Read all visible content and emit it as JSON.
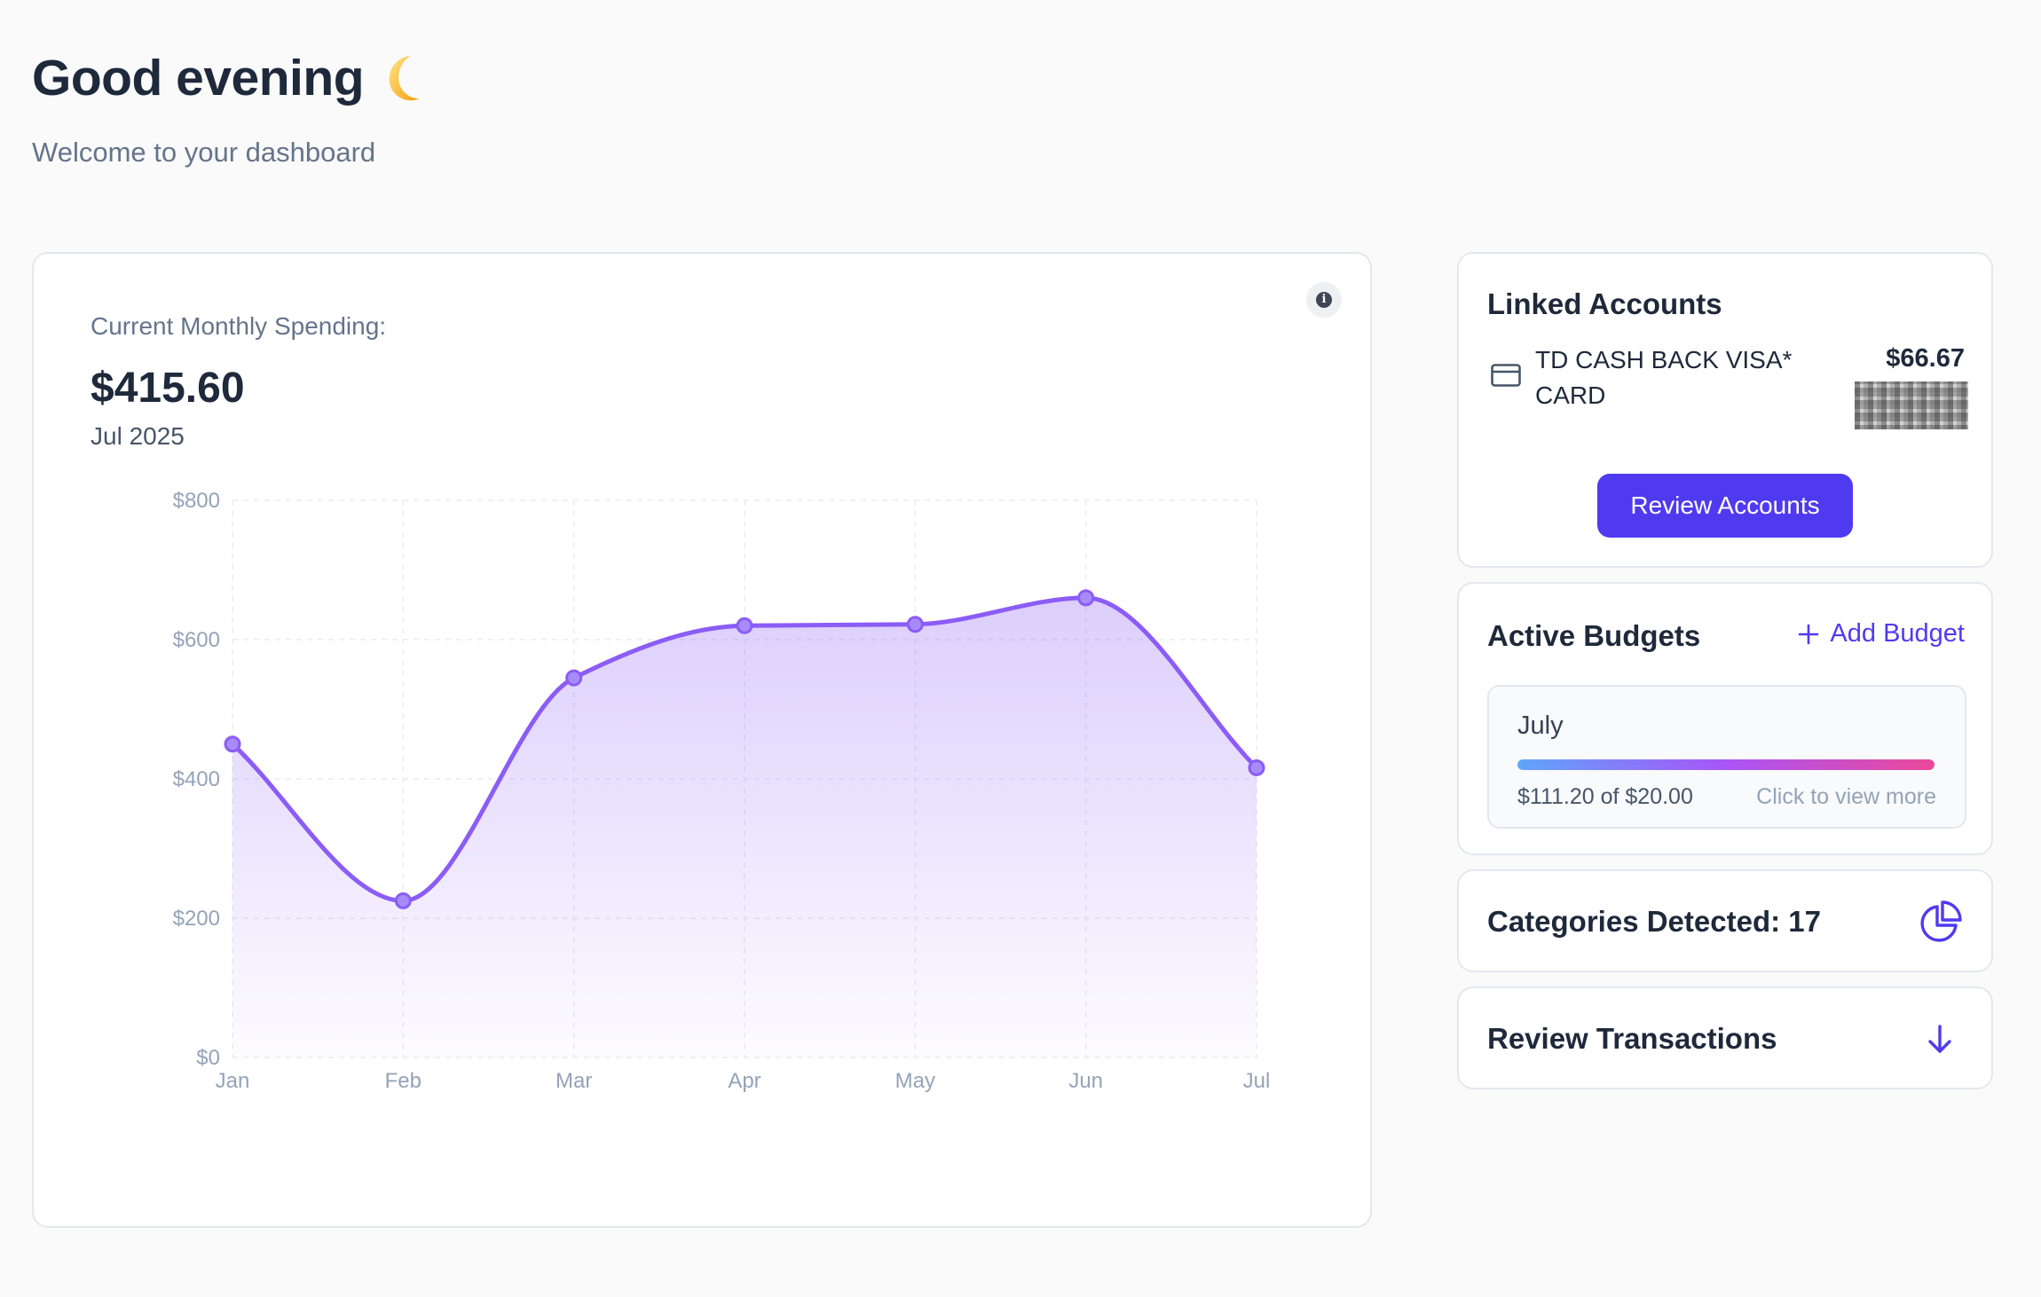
{
  "greeting": {
    "title": "Good evening",
    "subtitle": "Welcome to your dashboard",
    "icon": "crescent-moon-icon"
  },
  "spending": {
    "label": "Current Monthly Spending:",
    "value": "$415.60",
    "period": "Jul 2025"
  },
  "chart_data": {
    "type": "area",
    "categories": [
      "Jan",
      "Feb",
      "Mar",
      "Apr",
      "May",
      "Jun",
      "Jul"
    ],
    "series": [
      {
        "values": [
          450,
          225,
          545,
          620,
          622,
          660,
          416
        ]
      }
    ],
    "yticks": [
      "$0",
      "$200",
      "$400",
      "$600",
      "$800"
    ],
    "ytick_values": [
      0,
      200,
      400,
      600,
      800
    ],
    "ylim": [
      0,
      800
    ],
    "grid": true,
    "color": "#8b5cf6"
  },
  "linked_accounts": {
    "title": "Linked Accounts",
    "account_name": "TD CASH BACK VISA* CARD",
    "account_balance": "$66.67",
    "review_button": "Review Accounts"
  },
  "budgets": {
    "title": "Active Budgets",
    "add_label": "Add Budget",
    "item": {
      "name": "July",
      "amount": "$111.20 of $20.00",
      "more": "Click to view more",
      "progress": 1.0
    }
  },
  "categories": {
    "title": "Categories Detected: 17",
    "icon": "pie-chart-icon"
  },
  "transactions": {
    "title": "Review Transactions",
    "icon": "arrow-down-icon"
  },
  "colors": {
    "accent": "#4f3af0",
    "chart_line": "#8b5cf6"
  }
}
